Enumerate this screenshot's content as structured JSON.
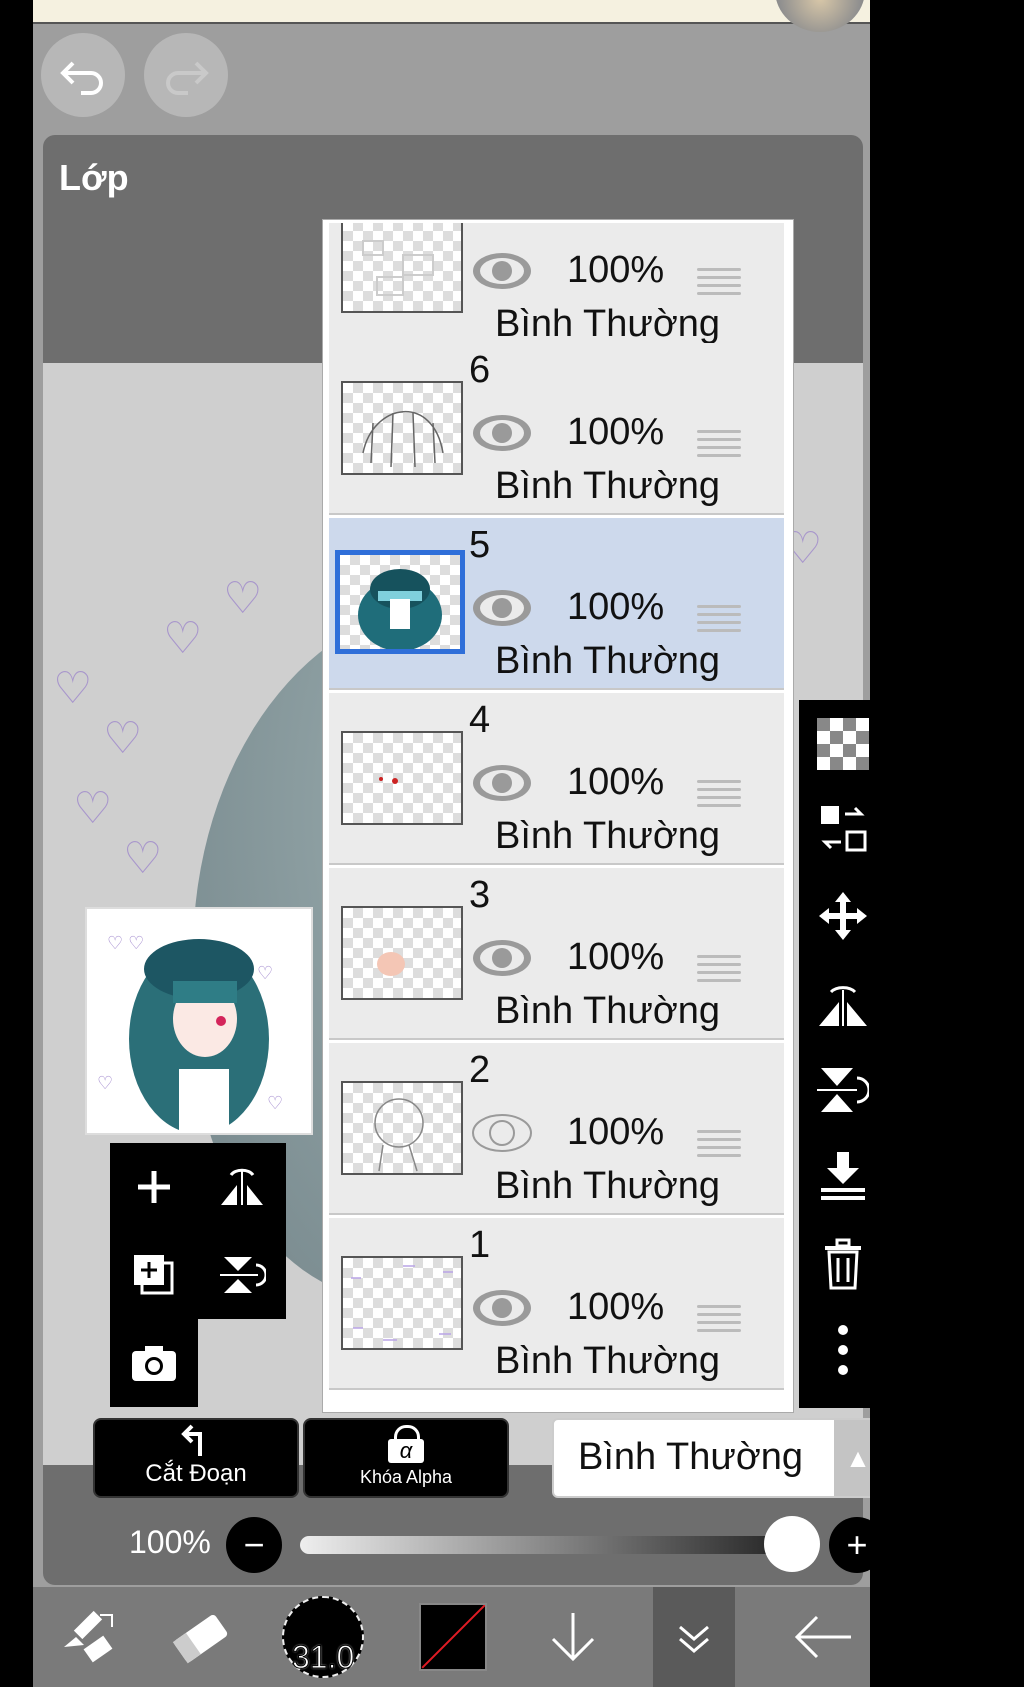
{
  "panel": {
    "title": "Lớp"
  },
  "layers": [
    {
      "number": "",
      "opacity": "100%",
      "blend": "Bình Thường",
      "visible": true,
      "selected": false
    },
    {
      "number": "6",
      "opacity": "100%",
      "blend": "Bình Thường",
      "visible": true,
      "selected": false
    },
    {
      "number": "5",
      "opacity": "100%",
      "blend": "Bình Thường",
      "visible": true,
      "selected": true
    },
    {
      "number": "4",
      "opacity": "100%",
      "blend": "Bình Thường",
      "visible": true,
      "selected": false
    },
    {
      "number": "3",
      "opacity": "100%",
      "blend": "Bình Thường",
      "visible": true,
      "selected": false
    },
    {
      "number": "2",
      "opacity": "100%",
      "blend": "Bình Thường",
      "visible": false,
      "selected": false
    },
    {
      "number": "1",
      "opacity": "100%",
      "blend": "Bình Thường",
      "visible": true,
      "selected": false
    }
  ],
  "actions": {
    "clipping_label": "Cắt Đoạn",
    "alpha_lock_label": "Khóa Alpha",
    "blend_mode": "Bình Thường",
    "alpha_symbol": "α"
  },
  "opacity": {
    "label": "100%",
    "value": 1.0
  },
  "brush": {
    "size": "31.0"
  },
  "icons": {
    "undo": "undo-icon",
    "redo": "redo-icon",
    "checker": "checkerboard-icon",
    "swap": "swap-layer-icon",
    "move": "move-icon",
    "flip_h": "flip-horizontal-icon",
    "flip_v": "flip-vertical-icon",
    "merge_down": "merge-down-icon",
    "trash": "trash-icon",
    "more": "more-icon"
  },
  "colors": {
    "accent": "#2f6fd9",
    "selected_row": "#cdd9ec",
    "row": "#ebebeb"
  }
}
